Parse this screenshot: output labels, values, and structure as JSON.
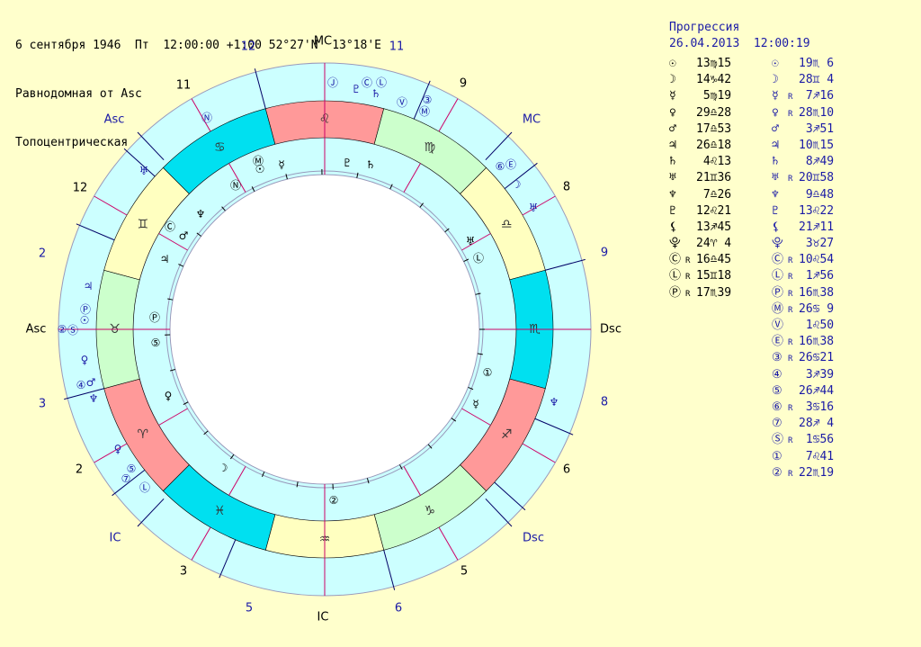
{
  "header": {
    "line1": "6 сентября 1946  Пт  12:00:00 +1:00 52°27'N  13°18'E",
    "line2": "Равнодомная от Asc",
    "line3": "Топоцентрическая"
  },
  "progression": {
    "title": "Прогрессия",
    "datetime": "26.04.2013  12:00:19"
  },
  "natal_positions": [
    {
      "glyph": "☉",
      "retro": "",
      "value": "13♍15"
    },
    {
      "glyph": "☽",
      "retro": "",
      "value": "14♑42"
    },
    {
      "glyph": "☿",
      "retro": "",
      "value": " 5♍19"
    },
    {
      "glyph": "♀",
      "retro": "",
      "value": "29♎28"
    },
    {
      "glyph": "♂",
      "retro": "",
      "value": "17♎53"
    },
    {
      "glyph": "♃",
      "retro": "",
      "value": "26♎18"
    },
    {
      "glyph": "♄",
      "retro": "",
      "value": " 4♌13"
    },
    {
      "glyph": "♅",
      "retro": "",
      "value": "21♊36"
    },
    {
      "glyph": "♆",
      "retro": "",
      "value": " 7♎26"
    },
    {
      "glyph": "♇",
      "retro": "",
      "value": "12♌21"
    },
    {
      "glyph": "⚸",
      "retro": "",
      "value": "13♐45"
    },
    {
      "glyph": "⯓",
      "retro": "",
      "value": "24♈ 4"
    },
    {
      "glyph": "Ⓒ",
      "retro": "R",
      "value": "16♎45"
    },
    {
      "glyph": "Ⓛ",
      "retro": "R",
      "value": "15♊18"
    },
    {
      "glyph": "Ⓟ",
      "retro": "R",
      "value": "17♏39"
    }
  ],
  "progressed_positions": [
    {
      "glyph": "☉",
      "retro": "",
      "value": "19♏ 6"
    },
    {
      "glyph": "☽",
      "retro": "",
      "value": "28♊ 4"
    },
    {
      "glyph": "☿",
      "retro": "R",
      "value": " 7♐16"
    },
    {
      "glyph": "♀",
      "retro": "R",
      "value": "28♏10"
    },
    {
      "glyph": "♂",
      "retro": "",
      "value": " 3♐51"
    },
    {
      "glyph": "♃",
      "retro": "",
      "value": "10♏15"
    },
    {
      "glyph": "♄",
      "retro": "",
      "value": " 8♐49"
    },
    {
      "glyph": "♅",
      "retro": "R",
      "value": "20♊58"
    },
    {
      "glyph": "♆",
      "retro": "",
      "value": " 9♎48"
    },
    {
      "glyph": "♇",
      "retro": "",
      "value": "13♌22"
    },
    {
      "glyph": "⚸",
      "retro": "",
      "value": "21♐11"
    },
    {
      "glyph": "⯓",
      "retro": "",
      "value": " 3♉27"
    },
    {
      "glyph": "Ⓒ",
      "retro": "R",
      "value": "10♌54"
    },
    {
      "glyph": "Ⓛ",
      "retro": "R",
      "value": " 1♐56"
    },
    {
      "glyph": "Ⓟ",
      "retro": "R",
      "value": "16♏38"
    },
    {
      "glyph": "Ⓜ",
      "retro": "R",
      "value": "26♋ 9"
    },
    {
      "glyph": "Ⓥ",
      "retro": "",
      "value": " 1♌50"
    },
    {
      "glyph": "Ⓔ",
      "retro": "R",
      "value": "16♏38"
    },
    {
      "glyph": "③",
      "retro": "R",
      "value": "26♋21"
    },
    {
      "glyph": "④",
      "retro": "",
      "value": " 3♐39"
    },
    {
      "glyph": "⑤",
      "retro": "",
      "value": "26♐44"
    },
    {
      "glyph": "⑥",
      "retro": "R",
      "value": " 3♋16"
    },
    {
      "glyph": "⑦",
      "retro": "",
      "value": "28♐ 4"
    },
    {
      "glyph": "Ⓢ",
      "retro": "R",
      "value": " 1♋56"
    },
    {
      "glyph": "①",
      "retro": "",
      "value": " 7♌41"
    },
    {
      "glyph": "②",
      "retro": "R",
      "value": "22♏19"
    }
  ],
  "chart": {
    "angle_labels": {
      "asc": "Asc",
      "mc": "MC",
      "dsc": "Dsc",
      "ic": "IC"
    },
    "natal_houses": [
      "1",
      "2",
      "3",
      "4",
      "5",
      "6",
      "7",
      "8",
      "9",
      "10",
      "11",
      "12"
    ],
    "outer_house_numbers": [
      {
        "label": "12",
        "color": "#1a1aa6"
      },
      {
        "label": "11",
        "color": "#1a1aa6"
      },
      {
        "label": "9",
        "color": "#000000"
      },
      {
        "label": "8",
        "color": "#000000"
      },
      {
        "label": "9",
        "color": "#1a1aa6"
      },
      {
        "label": "8",
        "color": "#1a1aa6"
      },
      {
        "label": "6",
        "color": "#000000"
      },
      {
        "label": "5",
        "color": "#000000"
      },
      {
        "label": "6",
        "color": "#1a1aa6"
      },
      {
        "label": "5",
        "color": "#1a1aa6"
      },
      {
        "label": "3",
        "color": "#000000"
      },
      {
        "label": "2",
        "color": "#000000"
      },
      {
        "label": "3",
        "color": "#1a1aa6"
      },
      {
        "label": "2",
        "color": "#1a1aa6"
      },
      {
        "label": "12",
        "color": "#000000"
      },
      {
        "label": "11",
        "color": "#000000"
      }
    ],
    "sign_glyphs": [
      "♈",
      "♉",
      "♊",
      "♋",
      "♌",
      "♍",
      "♎",
      "♏",
      "♐",
      "♑",
      "♒",
      "♓"
    ],
    "colors": {
      "background": "#ffffcc",
      "outer_ring": "#ccffff",
      "fire": "#ff9999",
      "earth": "#ccffcc",
      "air": "#ffffc0",
      "water": "#00e0f0",
      "house_line_natal": "#cc0066",
      "house_line_prog": "#000066",
      "prog_text": "#1a1aa6"
    }
  }
}
